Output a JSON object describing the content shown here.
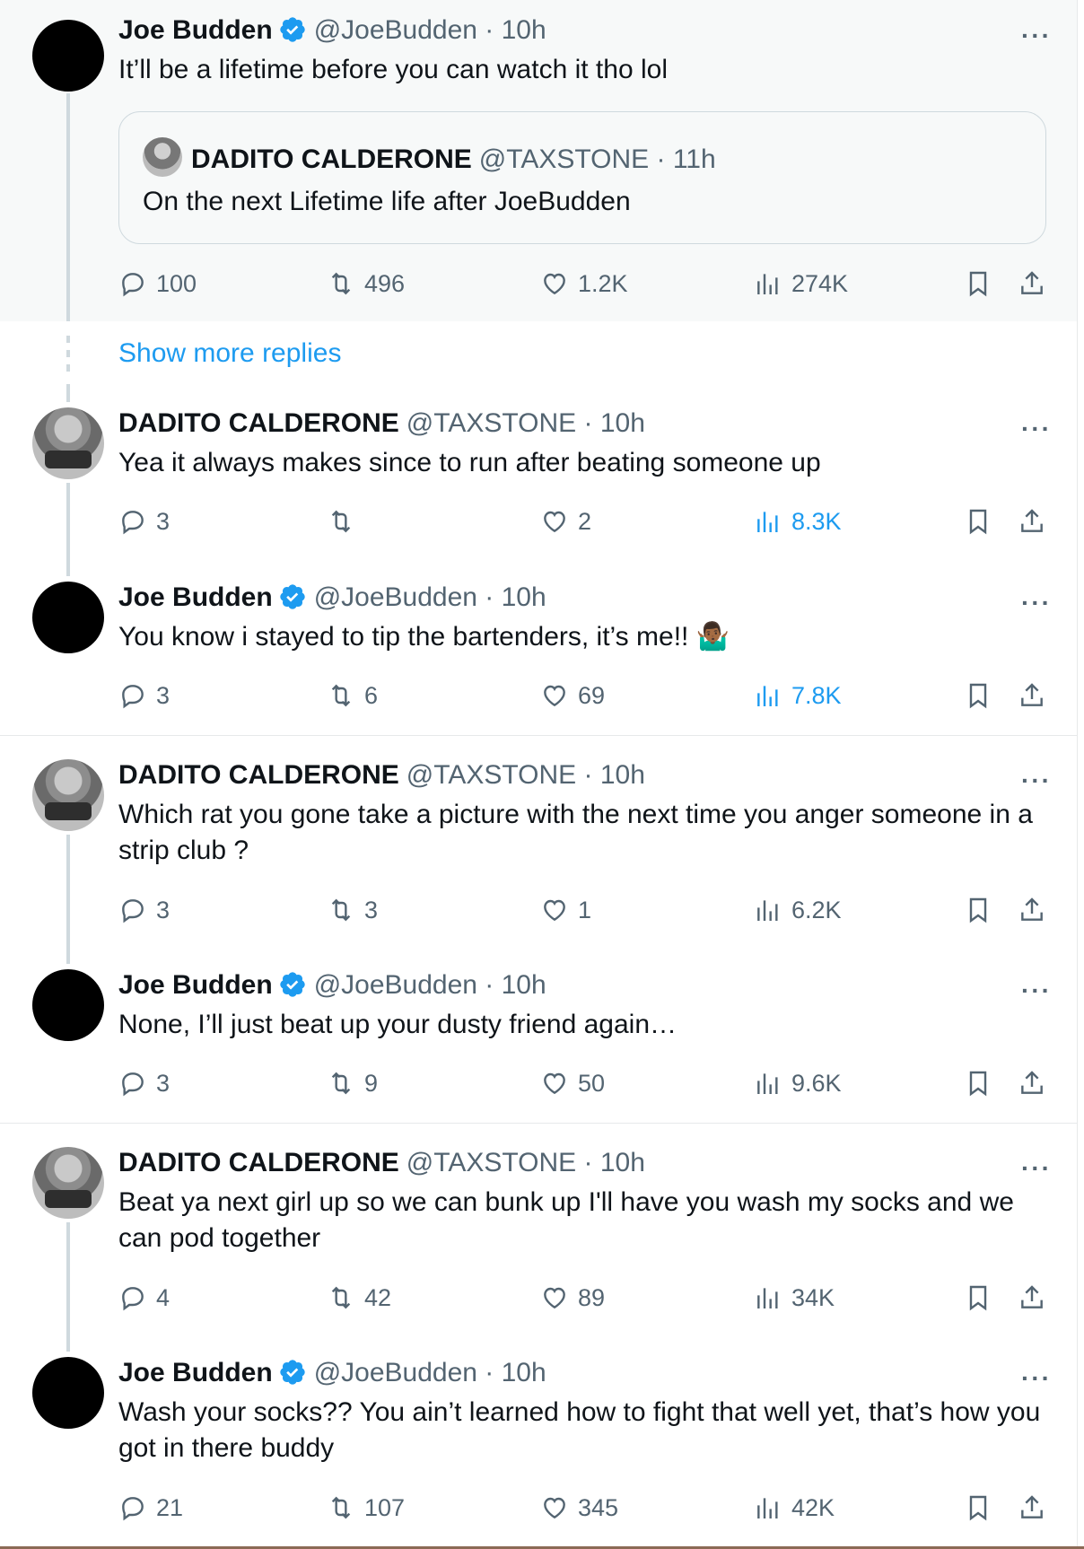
{
  "show_more_replies": "Show more replies",
  "quote": {
    "name": "DADITO CALDERONE",
    "handle": "@TAXSTONE · 11h",
    "text": "On the next Lifetime life after JoeBudden"
  },
  "tweets": [
    {
      "name": "Joe Budden",
      "verified": true,
      "handle": "@JoeBudden · 10h",
      "text": "It’ll be a lifetime before you can watch it tho lol",
      "replies": "100",
      "retweets": "496",
      "likes": "1.2K",
      "views": "274K"
    },
    {
      "name": "DADITO CALDERONE",
      "verified": false,
      "handle": "@TAXSTONE · 10h",
      "text": "Yea it always makes since to run after beating someone up",
      "replies": "3",
      "retweets": "",
      "likes": "2",
      "views": "8.3K"
    },
    {
      "name": "Joe Budden",
      "verified": true,
      "handle": "@JoeBudden · 10h",
      "text": "You know i stayed to tip the bartenders, it’s me!! 🤷🏾‍♂️",
      "replies": "3",
      "retweets": "6",
      "likes": "69",
      "views": "7.8K"
    },
    {
      "name": "DADITO CALDERONE",
      "verified": false,
      "handle": "@TAXSTONE · 10h",
      "text": "Which rat you gone take a picture with the next time you anger someone in a strip club ?",
      "replies": "3",
      "retweets": "3",
      "likes": "1",
      "views": "6.2K"
    },
    {
      "name": "Joe Budden",
      "verified": true,
      "handle": "@JoeBudden · 10h",
      "text": "None, I’ll just beat up your dusty friend again…",
      "replies": "3",
      "retweets": "9",
      "likes": "50",
      "views": "9.6K"
    },
    {
      "name": "DADITO CALDERONE",
      "verified": false,
      "handle": "@TAXSTONE · 10h",
      "text": "Beat ya next girl up so we can bunk up I'll have you wash my socks and we can pod together",
      "replies": "4",
      "retweets": "42",
      "likes": "89",
      "views": "34K"
    },
    {
      "name": "Joe Budden",
      "verified": true,
      "handle": "@JoeBudden · 10h",
      "text": "Wash your socks?? You ain’t learned how to fight that well yet, that’s how you got in there buddy",
      "replies": "21",
      "retweets": "107",
      "likes": "345",
      "views": "42K"
    }
  ],
  "colors": {
    "accent": "#1d9bf0",
    "text": "#0f1419",
    "muted": "#536471",
    "highlight_bg": "#f7f9f9"
  },
  "icons": [
    "more-icon",
    "verified-icon",
    "reply-icon",
    "retweet-icon",
    "like-icon",
    "views-icon",
    "bookmark-icon",
    "share-icon"
  ]
}
